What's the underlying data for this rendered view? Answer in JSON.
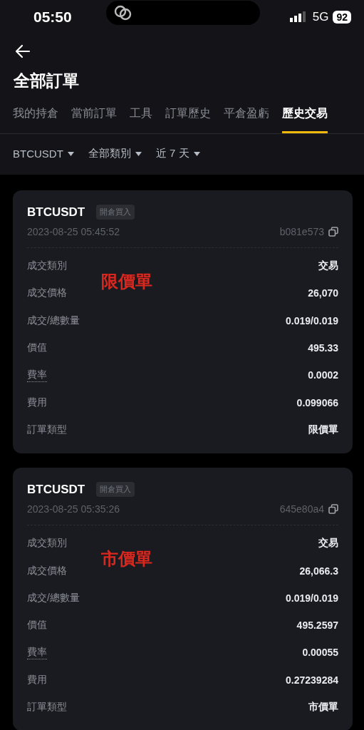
{
  "status_bar": {
    "time": "05:50",
    "network": "5G",
    "battery": "92"
  },
  "header": {
    "title": "全部訂單"
  },
  "tabs": [
    {
      "label": "我的持倉",
      "selected": false
    },
    {
      "label": "當前訂單",
      "selected": false
    },
    {
      "label": "工具",
      "selected": false
    },
    {
      "label": "訂單歷史",
      "selected": false
    },
    {
      "label": "平倉盈虧",
      "selected": false
    },
    {
      "label": "歷史交易",
      "selected": true
    }
  ],
  "filters": [
    {
      "label": "BTCUSDT"
    },
    {
      "label": "全部類別"
    },
    {
      "label": "近 7 天"
    }
  ],
  "trades": [
    {
      "symbol": "BTCUSDT",
      "tag": "開倉買入",
      "datetime": "2023-08-25 05:45:52",
      "order_id": "b081e573",
      "annotation": "限價單",
      "rows": [
        {
          "label": "成交類別",
          "value": "交易",
          "kind": "plain"
        },
        {
          "label": "成交價格",
          "value": "26,070",
          "kind": "plain"
        },
        {
          "label": "成交/總數量",
          "value": "0.019/0.019",
          "kind": "plain"
        },
        {
          "label": "價值",
          "value": "495.33",
          "kind": "plain"
        },
        {
          "label": "費率",
          "value": "0.0002",
          "kind": "hint"
        },
        {
          "label": "費用",
          "value": "0.099066",
          "kind": "plain"
        },
        {
          "label": "訂單類型",
          "value": "限價單",
          "kind": "plain"
        }
      ]
    },
    {
      "symbol": "BTCUSDT",
      "tag": "開倉買入",
      "datetime": "2023-08-25 05:35:26",
      "order_id": "645e80a4",
      "annotation": "市價單",
      "rows": [
        {
          "label": "成交類別",
          "value": "交易",
          "kind": "plain"
        },
        {
          "label": "成交價格",
          "value": "26,066.3",
          "kind": "plain"
        },
        {
          "label": "成交/總數量",
          "value": "0.019/0.019",
          "kind": "plain"
        },
        {
          "label": "價值",
          "value": "495.2597",
          "kind": "plain"
        },
        {
          "label": "費率",
          "value": "0.00055",
          "kind": "hint"
        },
        {
          "label": "費用",
          "value": "0.27239284",
          "kind": "plain"
        },
        {
          "label": "訂單類型",
          "value": "市價單",
          "kind": "plain"
        }
      ]
    }
  ]
}
